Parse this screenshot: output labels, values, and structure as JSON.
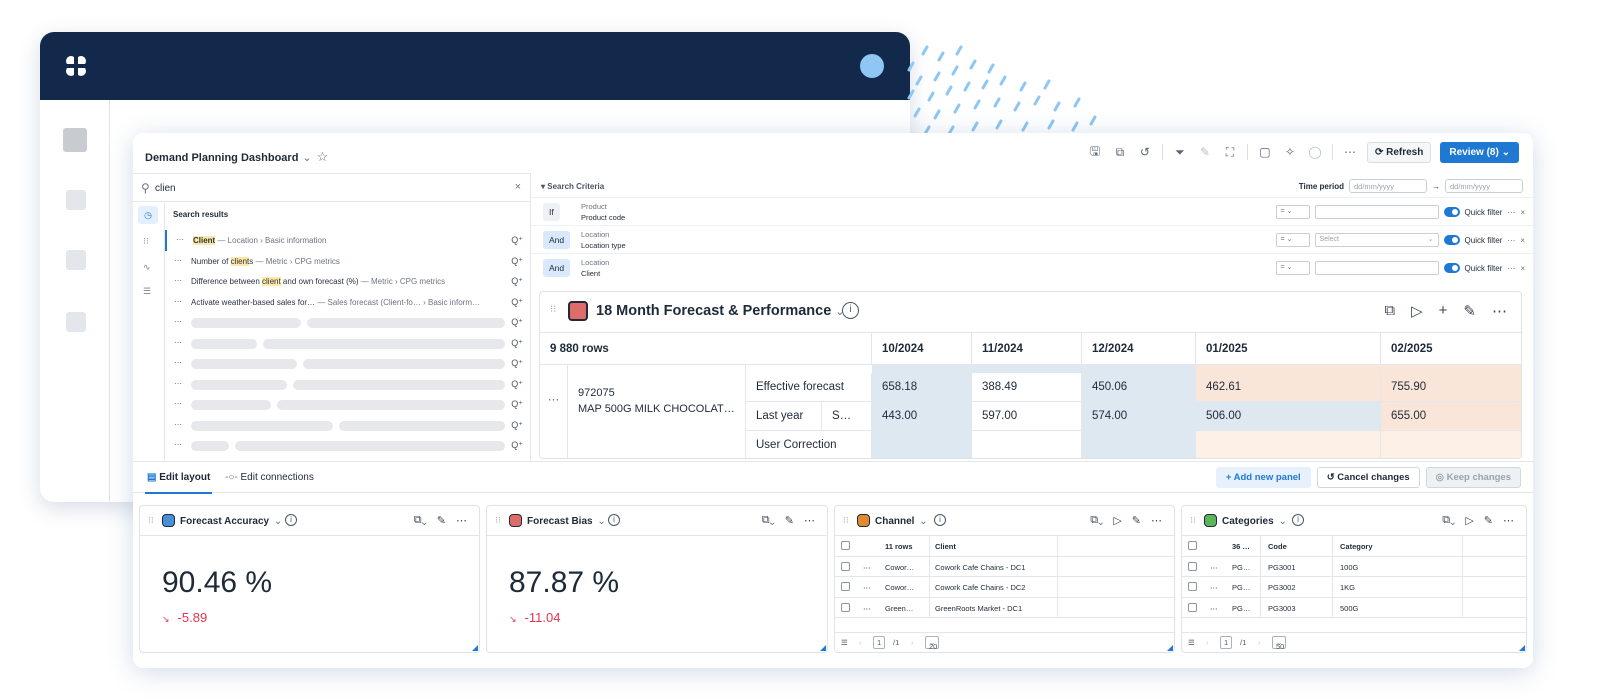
{
  "app": {
    "title": "Demand Planning Dashboard",
    "refresh_label": "Refresh",
    "review_label": "Review (8)",
    "accent": "#1f78d1",
    "header_color": "#13294b"
  },
  "search": {
    "query": "clien",
    "results_heading": "Search results",
    "results": [
      {
        "pre": "",
        "hl": "Client",
        "post": "",
        "path": " — Location › Basic information"
      },
      {
        "pre": "Number of ",
        "hl": "client",
        "post": "s",
        "path": " — Metric › CPG metrics"
      },
      {
        "pre": "Difference between ",
        "hl": "client",
        "post": " and own forecast (%)",
        "path": " — Metric › CPG metrics"
      },
      {
        "pre": "Activate weather-based sales for…",
        "hl": "",
        "post": "",
        "path": " — Sales forecast (Client-fo… › Basic inform…"
      }
    ]
  },
  "criteria": {
    "heading": "Search Criteria",
    "time_period_label": "Time period",
    "date_placeholder": "dd/mm/yyyy",
    "quick_filter_label": "Quick filter",
    "rows": [
      {
        "op": "If",
        "entity": "Product",
        "field": "Product code",
        "eq": "=",
        "value": ""
      },
      {
        "op": "And",
        "entity": "Location",
        "field": "Location type",
        "eq": "=",
        "value": "Select"
      },
      {
        "op": "And",
        "entity": "Location",
        "field": "Client",
        "eq": "=",
        "value": ""
      }
    ]
  },
  "forecast": {
    "title": "18 Month Forecast & Performance",
    "row_count": "9 880 rows",
    "months": [
      "10/2024",
      "11/2024",
      "12/2024",
      "01/2025",
      "02/2025"
    ],
    "product_code": "972075",
    "product_name": "MAP 500G MILK CHOCOLAT…",
    "measures": [
      {
        "label": "Effective forecast",
        "sub": "",
        "values": [
          "658.18",
          "388.49",
          "450.06",
          "462.61",
          "755.90"
        ]
      },
      {
        "label": "Last year",
        "sub": "S…",
        "values": [
          "443.00",
          "597.00",
          "574.00",
          "506.00",
          "655.00"
        ]
      },
      {
        "label": "User Correction",
        "sub": "",
        "values": [
          "",
          "",
          "",
          "",
          ""
        ]
      }
    ]
  },
  "bottom": {
    "tab_edit_layout": "Edit layout",
    "tab_edit_connections": "Edit connections",
    "add_panel": "+ Add new panel",
    "cancel": "Cancel changes",
    "keep": "Keep changes"
  },
  "widgets": {
    "accuracy": {
      "title": "Forecast Accuracy",
      "value": "90.46 %",
      "delta": "-5.89",
      "chip_color": "#4a90d9"
    },
    "bias": {
      "title": "Forecast Bias",
      "value": "87.87 %",
      "delta": "-11.04",
      "chip_color": "#e06b6b"
    },
    "channel": {
      "title": "Channel",
      "chip_color": "#e0892e",
      "headers": [
        "11 rows",
        "Client"
      ],
      "rows": [
        [
          "Cowor…",
          "Cowork Cafe Chains - DC1"
        ],
        [
          "Cowor…",
          "Cowork Cafe Chains - DC2"
        ],
        [
          "Green…",
          "GreenRoots Market - DC1"
        ]
      ],
      "page": "1",
      "pages": "/1",
      "page_size": "20"
    },
    "categories": {
      "title": "Categories",
      "chip_color": "#5bb55b",
      "headers": [
        "36 …",
        "Code",
        "Category"
      ],
      "rows": [
        [
          "PG…",
          "PG3001",
          "100G"
        ],
        [
          "PG…",
          "PG3002",
          "1KG"
        ],
        [
          "PG…",
          "PG3003",
          "500G"
        ]
      ],
      "page": "1",
      "pages": "/1",
      "page_size": "50"
    }
  }
}
